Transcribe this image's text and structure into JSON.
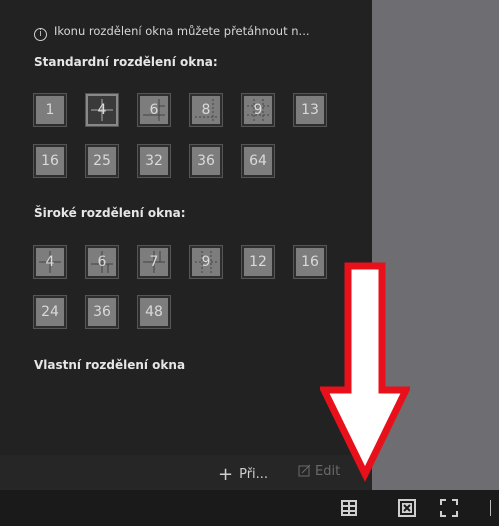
{
  "info_text": "Ikonu rozdělení okna můžete přetáhnout n...",
  "info_icon": "info-icon",
  "standard": {
    "title": "Standardní rozdělení okna:",
    "tiles": [
      "1",
      "4",
      "6",
      "8",
      "9",
      "13",
      "16",
      "25",
      "32",
      "36",
      "64"
    ],
    "selected": "4"
  },
  "wide": {
    "title": "Široké rozdělení okna:",
    "tiles": [
      "4",
      "6",
      "7",
      "9",
      "12",
      "16",
      "24",
      "36",
      "48"
    ]
  },
  "custom": {
    "title": "Vlastní rozdělení okna"
  },
  "footer": {
    "add_label": "Při...",
    "edit_label": "Edit"
  },
  "bottom_icons": [
    "window-division-icon",
    "close-window-icon",
    "fullscreen-icon"
  ],
  "annotation": {
    "arrow_color": "#e8101a",
    "arrow_direction": "down"
  }
}
